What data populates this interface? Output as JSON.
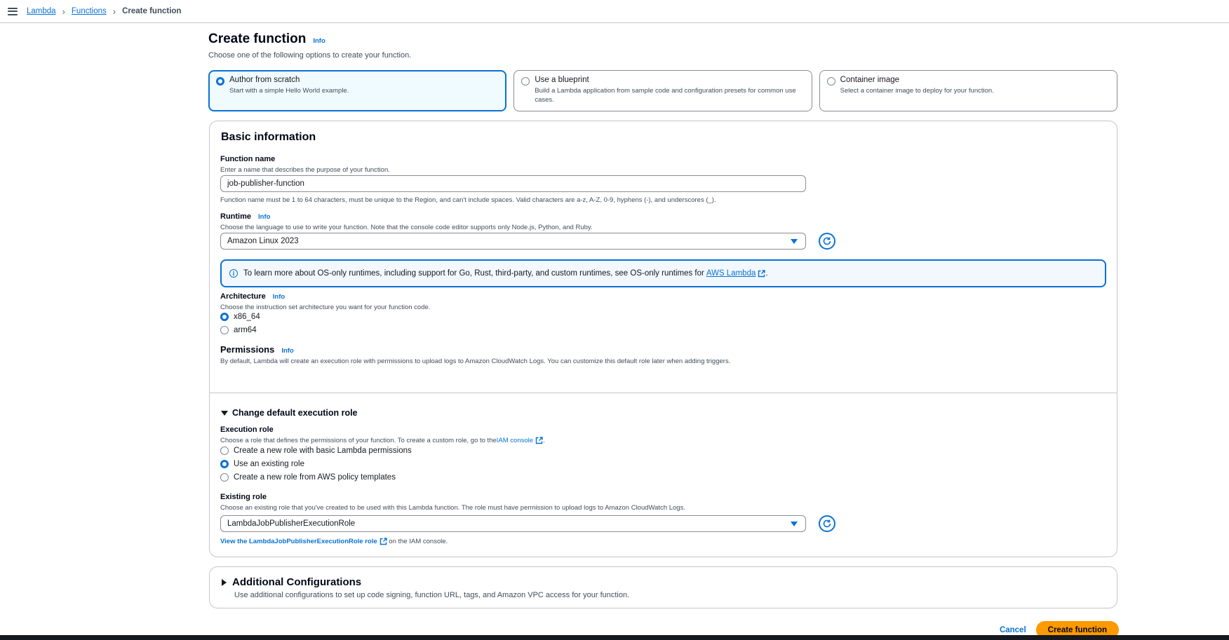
{
  "breadcrumb": {
    "items": [
      "Lambda",
      "Functions"
    ],
    "current": "Create function"
  },
  "page": {
    "title": "Create function",
    "info": "Info",
    "description": "Choose one of the following options to create your function."
  },
  "options": [
    {
      "title": "Author from scratch",
      "desc": "Start with a simple Hello World example.",
      "selected": true
    },
    {
      "title": "Use a blueprint",
      "desc": "Build a Lambda application from sample code and configuration presets for common use cases.",
      "selected": false
    },
    {
      "title": "Container image",
      "desc": "Select a container image to deploy for your function.",
      "selected": false
    }
  ],
  "basic": {
    "title": "Basic information",
    "function_name": {
      "label": "Function name",
      "help": "Enter a name that describes the purpose of your function.",
      "value": "job-publisher-function",
      "constraint": "Function name must be 1 to 64 characters, must be unique to the Region, and can't include spaces. Valid characters are a-z, A-Z, 0-9, hyphens (-), and underscores (_)."
    },
    "runtime": {
      "label": "Runtime",
      "info": "Info",
      "help": "Choose the language to use to write your function. Note that the console code editor supports only Node.js, Python, and Ruby.",
      "value": "Amazon Linux 2023"
    },
    "alert": {
      "text": "To learn more about OS-only runtimes, including support for Go, Rust, third-party, and custom runtimes, see OS-only runtimes for ",
      "link": "AWS Lambda",
      "suffix": "."
    },
    "architecture": {
      "label": "Architecture",
      "info": "Info",
      "help": "Choose the instruction set architecture you want for your function code.",
      "options": [
        "x86_64",
        "arm64"
      ],
      "selected": "x86_64"
    },
    "permissions": {
      "label": "Permissions",
      "info": "Info",
      "help": "By default, Lambda will create an execution role with permissions to upload logs to Amazon CloudWatch Logs. You can customize this default role later when adding triggers."
    },
    "execution": {
      "expander": "Change default execution role",
      "label": "Execution role",
      "help": "Choose a role that defines the permissions of your function. To create a custom role, go to the ",
      "help_link": "IAM console",
      "help_suffix": ".",
      "options": [
        "Create a new role with basic Lambda permissions",
        "Use an existing role",
        "Create a new role from AWS policy templates"
      ],
      "selected": "Use an existing role"
    },
    "existing_role": {
      "label": "Existing role",
      "help": "Choose an existing role that you've created to be used with this Lambda function. The role must have permission to upload logs to Amazon CloudWatch Logs.",
      "value": "LambdaJobPublisherExecutionRole",
      "view_link": "View the LambdaJobPublisherExecutionRole role",
      "view_suffix": " on the IAM console."
    }
  },
  "additional": {
    "title": "Additional Configurations",
    "desc": "Use additional configurations to set up code signing, function URL, tags, and Amazon VPC access for your function."
  },
  "actions": {
    "cancel": "Cancel",
    "create": "Create function"
  },
  "colors": {
    "accent": "#0972d3",
    "primary_button": "#ff9900",
    "selected_tile_bg": "#f0fbff"
  }
}
